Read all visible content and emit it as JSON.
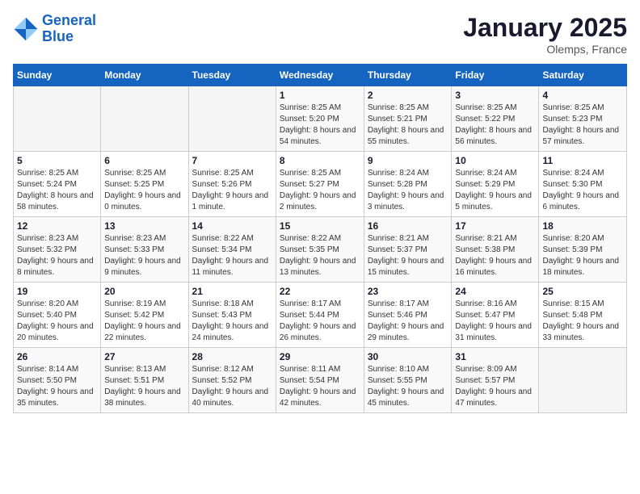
{
  "header": {
    "logo_line1": "General",
    "logo_line2": "Blue",
    "month_title": "January 2025",
    "location": "Olemps, France"
  },
  "weekdays": [
    "Sunday",
    "Monday",
    "Tuesday",
    "Wednesday",
    "Thursday",
    "Friday",
    "Saturday"
  ],
  "weeks": [
    [
      {
        "day": "",
        "sunrise": "",
        "sunset": "",
        "daylight": ""
      },
      {
        "day": "",
        "sunrise": "",
        "sunset": "",
        "daylight": ""
      },
      {
        "day": "",
        "sunrise": "",
        "sunset": "",
        "daylight": ""
      },
      {
        "day": "1",
        "sunrise": "Sunrise: 8:25 AM",
        "sunset": "Sunset: 5:20 PM",
        "daylight": "Daylight: 8 hours and 54 minutes."
      },
      {
        "day": "2",
        "sunrise": "Sunrise: 8:25 AM",
        "sunset": "Sunset: 5:21 PM",
        "daylight": "Daylight: 8 hours and 55 minutes."
      },
      {
        "day": "3",
        "sunrise": "Sunrise: 8:25 AM",
        "sunset": "Sunset: 5:22 PM",
        "daylight": "Daylight: 8 hours and 56 minutes."
      },
      {
        "day": "4",
        "sunrise": "Sunrise: 8:25 AM",
        "sunset": "Sunset: 5:23 PM",
        "daylight": "Daylight: 8 hours and 57 minutes."
      }
    ],
    [
      {
        "day": "5",
        "sunrise": "Sunrise: 8:25 AM",
        "sunset": "Sunset: 5:24 PM",
        "daylight": "Daylight: 8 hours and 58 minutes."
      },
      {
        "day": "6",
        "sunrise": "Sunrise: 8:25 AM",
        "sunset": "Sunset: 5:25 PM",
        "daylight": "Daylight: 9 hours and 0 minutes."
      },
      {
        "day": "7",
        "sunrise": "Sunrise: 8:25 AM",
        "sunset": "Sunset: 5:26 PM",
        "daylight": "Daylight: 9 hours and 1 minute."
      },
      {
        "day": "8",
        "sunrise": "Sunrise: 8:25 AM",
        "sunset": "Sunset: 5:27 PM",
        "daylight": "Daylight: 9 hours and 2 minutes."
      },
      {
        "day": "9",
        "sunrise": "Sunrise: 8:24 AM",
        "sunset": "Sunset: 5:28 PM",
        "daylight": "Daylight: 9 hours and 3 minutes."
      },
      {
        "day": "10",
        "sunrise": "Sunrise: 8:24 AM",
        "sunset": "Sunset: 5:29 PM",
        "daylight": "Daylight: 9 hours and 5 minutes."
      },
      {
        "day": "11",
        "sunrise": "Sunrise: 8:24 AM",
        "sunset": "Sunset: 5:30 PM",
        "daylight": "Daylight: 9 hours and 6 minutes."
      }
    ],
    [
      {
        "day": "12",
        "sunrise": "Sunrise: 8:23 AM",
        "sunset": "Sunset: 5:32 PM",
        "daylight": "Daylight: 9 hours and 8 minutes."
      },
      {
        "day": "13",
        "sunrise": "Sunrise: 8:23 AM",
        "sunset": "Sunset: 5:33 PM",
        "daylight": "Daylight: 9 hours and 9 minutes."
      },
      {
        "day": "14",
        "sunrise": "Sunrise: 8:22 AM",
        "sunset": "Sunset: 5:34 PM",
        "daylight": "Daylight: 9 hours and 11 minutes."
      },
      {
        "day": "15",
        "sunrise": "Sunrise: 8:22 AM",
        "sunset": "Sunset: 5:35 PM",
        "daylight": "Daylight: 9 hours and 13 minutes."
      },
      {
        "day": "16",
        "sunrise": "Sunrise: 8:21 AM",
        "sunset": "Sunset: 5:37 PM",
        "daylight": "Daylight: 9 hours and 15 minutes."
      },
      {
        "day": "17",
        "sunrise": "Sunrise: 8:21 AM",
        "sunset": "Sunset: 5:38 PM",
        "daylight": "Daylight: 9 hours and 16 minutes."
      },
      {
        "day": "18",
        "sunrise": "Sunrise: 8:20 AM",
        "sunset": "Sunset: 5:39 PM",
        "daylight": "Daylight: 9 hours and 18 minutes."
      }
    ],
    [
      {
        "day": "19",
        "sunrise": "Sunrise: 8:20 AM",
        "sunset": "Sunset: 5:40 PM",
        "daylight": "Daylight: 9 hours and 20 minutes."
      },
      {
        "day": "20",
        "sunrise": "Sunrise: 8:19 AM",
        "sunset": "Sunset: 5:42 PM",
        "daylight": "Daylight: 9 hours and 22 minutes."
      },
      {
        "day": "21",
        "sunrise": "Sunrise: 8:18 AM",
        "sunset": "Sunset: 5:43 PM",
        "daylight": "Daylight: 9 hours and 24 minutes."
      },
      {
        "day": "22",
        "sunrise": "Sunrise: 8:17 AM",
        "sunset": "Sunset: 5:44 PM",
        "daylight": "Daylight: 9 hours and 26 minutes."
      },
      {
        "day": "23",
        "sunrise": "Sunrise: 8:17 AM",
        "sunset": "Sunset: 5:46 PM",
        "daylight": "Daylight: 9 hours and 29 minutes."
      },
      {
        "day": "24",
        "sunrise": "Sunrise: 8:16 AM",
        "sunset": "Sunset: 5:47 PM",
        "daylight": "Daylight: 9 hours and 31 minutes."
      },
      {
        "day": "25",
        "sunrise": "Sunrise: 8:15 AM",
        "sunset": "Sunset: 5:48 PM",
        "daylight": "Daylight: 9 hours and 33 minutes."
      }
    ],
    [
      {
        "day": "26",
        "sunrise": "Sunrise: 8:14 AM",
        "sunset": "Sunset: 5:50 PM",
        "daylight": "Daylight: 9 hours and 35 minutes."
      },
      {
        "day": "27",
        "sunrise": "Sunrise: 8:13 AM",
        "sunset": "Sunset: 5:51 PM",
        "daylight": "Daylight: 9 hours and 38 minutes."
      },
      {
        "day": "28",
        "sunrise": "Sunrise: 8:12 AM",
        "sunset": "Sunset: 5:52 PM",
        "daylight": "Daylight: 9 hours and 40 minutes."
      },
      {
        "day": "29",
        "sunrise": "Sunrise: 8:11 AM",
        "sunset": "Sunset: 5:54 PM",
        "daylight": "Daylight: 9 hours and 42 minutes."
      },
      {
        "day": "30",
        "sunrise": "Sunrise: 8:10 AM",
        "sunset": "Sunset: 5:55 PM",
        "daylight": "Daylight: 9 hours and 45 minutes."
      },
      {
        "day": "31",
        "sunrise": "Sunrise: 8:09 AM",
        "sunset": "Sunset: 5:57 PM",
        "daylight": "Daylight: 9 hours and 47 minutes."
      },
      {
        "day": "",
        "sunrise": "",
        "sunset": "",
        "daylight": ""
      }
    ]
  ]
}
